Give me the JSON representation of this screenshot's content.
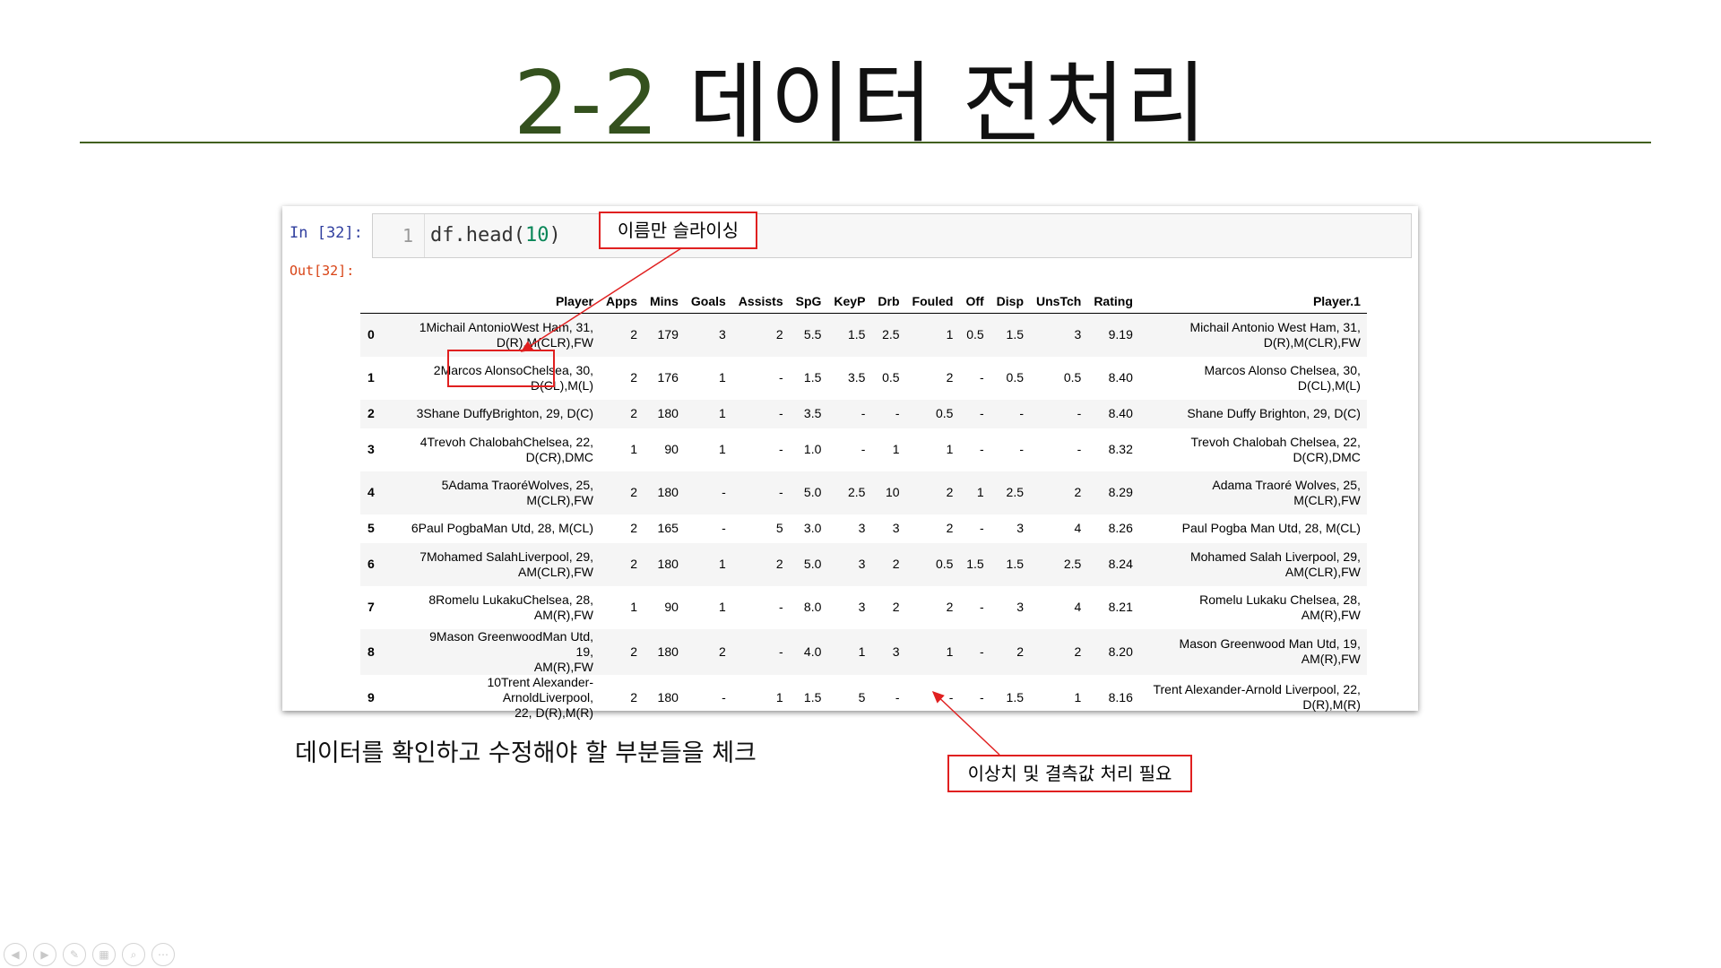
{
  "slide": {
    "title_number": "2-2",
    "title_text": "데이터 전처리",
    "caption": "데이터를 확인하고 수정해야 할 부분들을 체크"
  },
  "notebook": {
    "in_prompt": "In [32]:",
    "out_prompt": "Out[32]:",
    "line_number": "1",
    "code_prefix": "df.head(",
    "code_arg": "10",
    "code_suffix": ")"
  },
  "dataframe": {
    "columns": [
      "",
      "Player",
      "Apps",
      "Mins",
      "Goals",
      "Assists",
      "SpG",
      "KeyP",
      "Drb",
      "Fouled",
      "Off",
      "Disp",
      "UnsTch",
      "Rating",
      "Player.1"
    ],
    "rows": [
      {
        "index": "0",
        "player_l1": "1Michail AntonioWest Ham, 31,",
        "player_l2": "D(R),M(CLR),FW",
        "apps": "2",
        "mins": "179",
        "goals": "3",
        "assists": "2",
        "spg": "5.5",
        "keyp": "1.5",
        "drb": "2.5",
        "fouled": "1",
        "off": "0.5",
        "disp": "1.5",
        "unstch": "3",
        "rating": "9.19",
        "player1_l1": "Michail Antonio West Ham, 31,",
        "player1_l2": "D(R),M(CLR),FW"
      },
      {
        "index": "1",
        "player_l1": "2Marcos AlonsoChelsea, 30,",
        "player_l2": "D(CL),M(L)",
        "apps": "2",
        "mins": "176",
        "goals": "1",
        "assists": "-",
        "spg": "1.5",
        "keyp": "3.5",
        "drb": "0.5",
        "fouled": "2",
        "off": "-",
        "disp": "0.5",
        "unstch": "0.5",
        "rating": "8.40",
        "player1_l1": "Marcos Alonso Chelsea, 30,",
        "player1_l2": "D(CL),M(L)"
      },
      {
        "index": "2",
        "player_l1": "3Shane DuffyBrighton, 29, D(C)",
        "player_l2": "",
        "apps": "2",
        "mins": "180",
        "goals": "1",
        "assists": "-",
        "spg": "3.5",
        "keyp": "-",
        "drb": "-",
        "fouled": "0.5",
        "off": "-",
        "disp": "-",
        "unstch": "-",
        "rating": "8.40",
        "player1_l1": "Shane Duffy Brighton, 29, D(C)",
        "player1_l2": ""
      },
      {
        "index": "3",
        "player_l1": "4Trevoh ChalobahChelsea, 22,",
        "player_l2": "D(CR),DMC",
        "apps": "1",
        "mins": "90",
        "goals": "1",
        "assists": "-",
        "spg": "1.0",
        "keyp": "-",
        "drb": "1",
        "fouled": "1",
        "off": "-",
        "disp": "-",
        "unstch": "-",
        "rating": "8.32",
        "player1_l1": "Trevoh Chalobah Chelsea, 22,",
        "player1_l2": "D(CR),DMC"
      },
      {
        "index": "4",
        "player_l1": "5Adama TraoréWolves, 25,",
        "player_l2": "M(CLR),FW",
        "apps": "2",
        "mins": "180",
        "goals": "-",
        "assists": "-",
        "spg": "5.0",
        "keyp": "2.5",
        "drb": "10",
        "fouled": "2",
        "off": "1",
        "disp": "2.5",
        "unstch": "2",
        "rating": "8.29",
        "player1_l1": "Adama Traoré Wolves, 25,",
        "player1_l2": "M(CLR),FW"
      },
      {
        "index": "5",
        "player_l1": "6Paul PogbaMan Utd, 28, M(CL)",
        "player_l2": "",
        "apps": "2",
        "mins": "165",
        "goals": "-",
        "assists": "5",
        "spg": "3.0",
        "keyp": "3",
        "drb": "3",
        "fouled": "2",
        "off": "-",
        "disp": "3",
        "unstch": "4",
        "rating": "8.26",
        "player1_l1": "Paul Pogba Man Utd, 28, M(CL)",
        "player1_l2": ""
      },
      {
        "index": "6",
        "player_l1": "7Mohamed SalahLiverpool, 29,",
        "player_l2": "AM(CLR),FW",
        "apps": "2",
        "mins": "180",
        "goals": "1",
        "assists": "2",
        "spg": "5.0",
        "keyp": "3",
        "drb": "2",
        "fouled": "0.5",
        "off": "1.5",
        "disp": "1.5",
        "unstch": "2.5",
        "rating": "8.24",
        "player1_l1": "Mohamed Salah Liverpool, 29,",
        "player1_l2": "AM(CLR),FW"
      },
      {
        "index": "7",
        "player_l1": "8Romelu LukakuChelsea, 28,",
        "player_l2": "AM(R),FW",
        "apps": "1",
        "mins": "90",
        "goals": "1",
        "assists": "-",
        "spg": "8.0",
        "keyp": "3",
        "drb": "2",
        "fouled": "2",
        "off": "-",
        "disp": "3",
        "unstch": "4",
        "rating": "8.21",
        "player1_l1": "Romelu Lukaku Chelsea, 28,",
        "player1_l2": "AM(R),FW"
      },
      {
        "index": "8",
        "player_l1": "9Mason GreenwoodMan Utd, 19,",
        "player_l2": "AM(R),FW",
        "apps": "2",
        "mins": "180",
        "goals": "2",
        "assists": "-",
        "spg": "4.0",
        "keyp": "1",
        "drb": "3",
        "fouled": "1",
        "off": "-",
        "disp": "2",
        "unstch": "2",
        "rating": "8.20",
        "player1_l1": "Mason Greenwood Man Utd, 19,",
        "player1_l2": "AM(R),FW"
      },
      {
        "index": "9",
        "player_l1": "10Trent Alexander-ArnoldLiverpool,",
        "player_l2": "22, D(R),M(R)",
        "apps": "2",
        "mins": "180",
        "goals": "-",
        "assists": "1",
        "spg": "1.5",
        "keyp": "5",
        "drb": "-",
        "fouled": "-",
        "off": "-",
        "disp": "1.5",
        "unstch": "1",
        "rating": "8.16",
        "player1_l1": "Trent Alexander-Arnold Liverpool, 22,",
        "player1_l2": "D(R),M(R)"
      }
    ]
  },
  "annotations": {
    "slice_label": "이름만 슬라이싱",
    "outlier_label": "이상치 및 결측값 처리 필요",
    "color": "#e02020"
  },
  "theme": {
    "title_number_color": "#34511e",
    "rule_color": "#41601f"
  },
  "toolbar": [
    "prev-icon",
    "next-icon",
    "pen-icon",
    "slides-icon",
    "zoom-icon",
    "more-icon"
  ]
}
